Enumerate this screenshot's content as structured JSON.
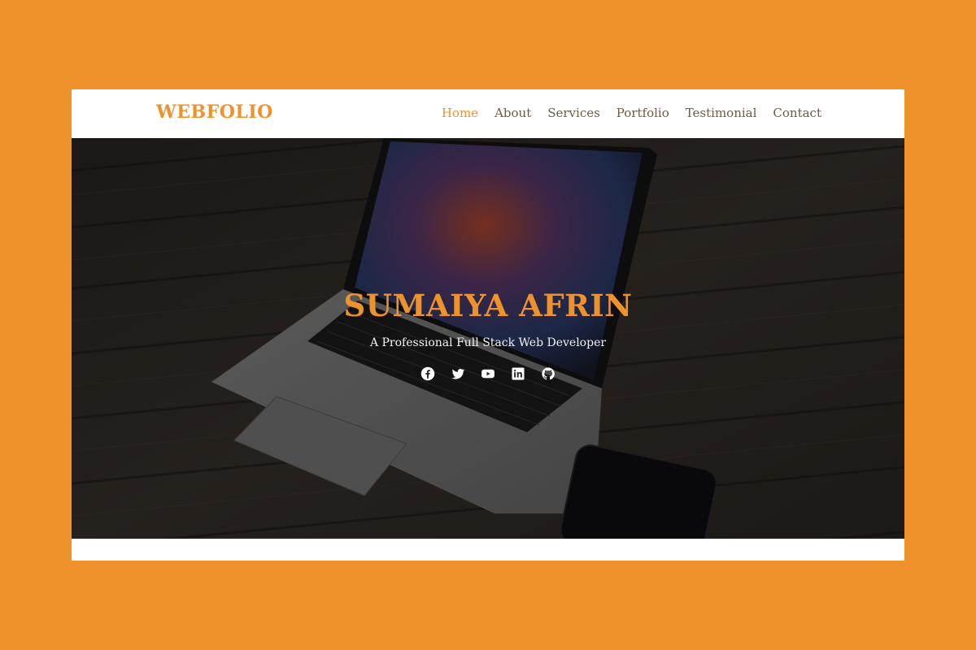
{
  "brand": {
    "logo_text": "WEBFOLIO",
    "accent_color": "#EF922C"
  },
  "nav": {
    "items": [
      {
        "label": "Home",
        "active": true
      },
      {
        "label": "About",
        "active": false
      },
      {
        "label": "Services",
        "active": false
      },
      {
        "label": "Portfolio",
        "active": false
      },
      {
        "label": "Testimonial",
        "active": false
      },
      {
        "label": "Contact",
        "active": false
      }
    ]
  },
  "hero": {
    "name": "SUMAIYA AFRIN",
    "tagline": "A Professional Full Stack Web Developer",
    "background": "laptop-on-wood-floor-photo",
    "socials": [
      {
        "icon": "facebook-icon"
      },
      {
        "icon": "twitter-icon"
      },
      {
        "icon": "youtube-icon"
      },
      {
        "icon": "linkedin-icon"
      },
      {
        "icon": "github-icon"
      }
    ]
  }
}
